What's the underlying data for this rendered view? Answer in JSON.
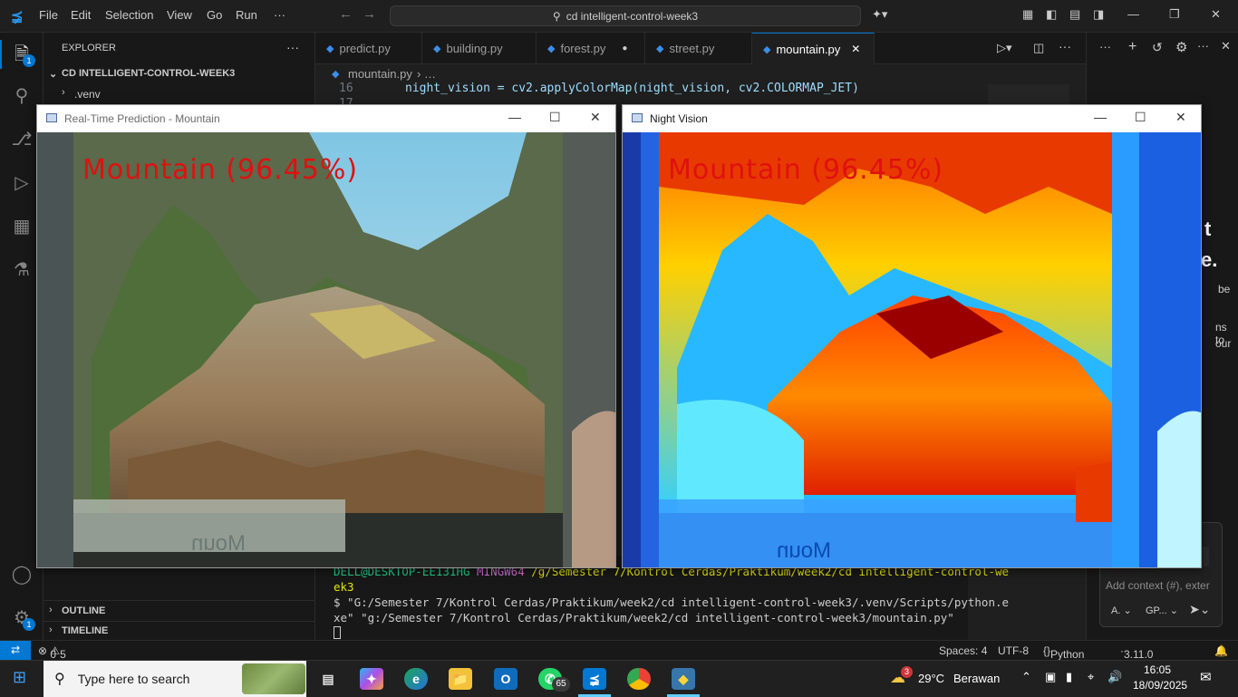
{
  "menu": [
    "File",
    "Edit",
    "Selection",
    "View",
    "Go",
    "Run",
    "···"
  ],
  "command_center": "cd intelligent-control-week3",
  "sidebar": {
    "title": "EXPLORER",
    "folder": "CD INTELLIGENT-CONTROL-WEEK3",
    "items": [
      ".venv"
    ],
    "outline": "OUTLINE",
    "timeline": "TIMELINE"
  },
  "activity_badges": {
    "explorer": "1",
    "settings": "1"
  },
  "tabs": [
    {
      "label": "predict.py"
    },
    {
      "label": "building.py"
    },
    {
      "label": "forest.py"
    },
    {
      "label": "street.py"
    },
    {
      "label": "mountain.py"
    }
  ],
  "breadcrumb": {
    "file": "mountain.py",
    "rest": "› …"
  },
  "code": {
    "line_number": "16",
    "line_number_2": "17",
    "line_text": "night_vision = cv2.applyColorMap(night_vision, cv2.COLORMAP_JET)"
  },
  "terminal": {
    "prompt_user": "DELL@DESKTOP-EE131HG",
    "prompt_env": "MINGW64",
    "prompt_path": "/g/Semester 7/Kontrol Cerdas/Praktikum/week2/cd intelligent-control-we",
    "prompt_path_2": "ek3",
    "command_1": "$ \"G:/Semester 7/Kontrol Cerdas/Praktikum/week2/cd intelligent-control-week3/.venv/Scripts/python.e",
    "command_2": "xe\" \"g:/Semester 7/Kontrol Cerdas/Praktikum/week2/cd intelligent-control-week3/mountain.py\""
  },
  "right_panel": {
    "placeholder": "Add context (#), exter",
    "agent": "A.",
    "model": "GP...",
    "fragments": [
      "t",
      "e.",
      "be",
      "ns to",
      "our"
    ]
  },
  "windows": {
    "left_title": "Real-Time Prediction - Mountain",
    "right_title": "Night Vision",
    "prediction": "Mountain (96.45%)",
    "watermark": "Moun"
  },
  "statusbar": {
    "errors": "0",
    "warnings": "5",
    "spaces": "Spaces: 4",
    "encoding": "UTF-8",
    "language": "Python",
    "interpreter": "3.11.0 (.venv)"
  },
  "taskbar": {
    "search_placeholder": "Type here to search",
    "whatsapp_badge": "65",
    "weather_badge": "3",
    "temperature": "29°C",
    "weather": "Berawan",
    "time": "16:05",
    "date": "18/09/2025"
  },
  "colors": {
    "accent": "#0078d4",
    "prediction_text": "#e01010"
  }
}
